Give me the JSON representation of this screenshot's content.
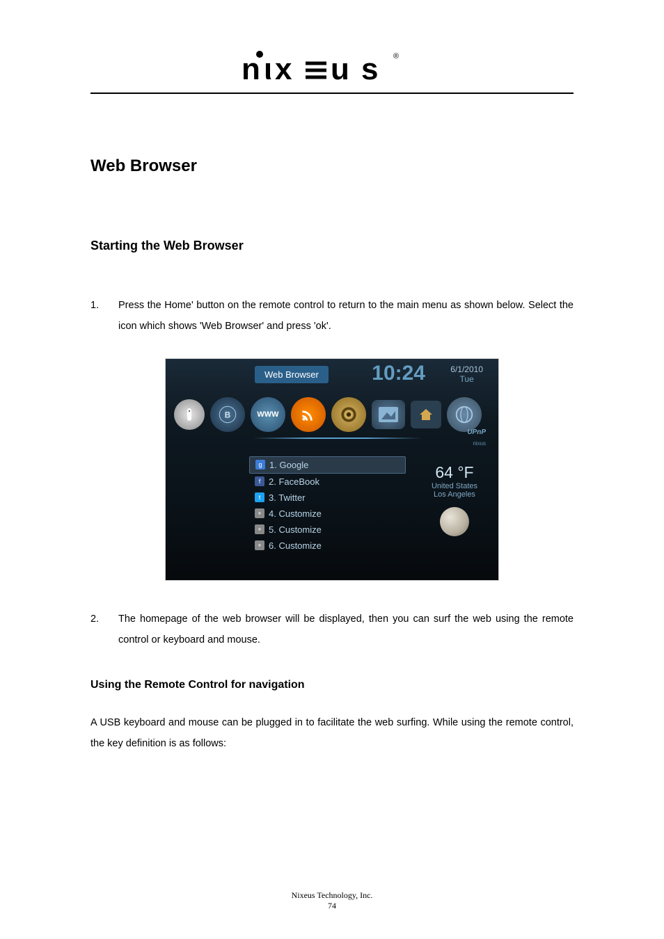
{
  "logo_text": "nixeus",
  "section_title": "Web Browser",
  "subsection_title": "Starting the Web Browser",
  "steps": [
    {
      "num": "1.",
      "text": "Press the Home' button on the remote control to return to the main menu as shown below. Select the icon which shows 'Web Browser' and press 'ok'."
    },
    {
      "num": "2.",
      "text": "The homepage of the web browser will be displayed, then you can surf the web using the remote control or keyboard and mouse."
    }
  ],
  "subsub_title": "Using the Remote Control for navigation",
  "body_para": "A USB keyboard and mouse can be plugged in to facilitate the web surfing. While using the remote control, the key definition is as follows:",
  "screenshot": {
    "title": "Web Browser",
    "time": "10:24",
    "date": "6/1/2010",
    "day": "Tue",
    "icon_www": "WWW",
    "upnp_label": "UPnP",
    "sub_label": "nixus",
    "list": [
      {
        "icon_bg": "#3b7dd8",
        "icon_char": "g",
        "label": "1. Google",
        "selected": true
      },
      {
        "icon_bg": "#3b5998",
        "icon_char": "f",
        "label": "2. FaceBook",
        "selected": false
      },
      {
        "icon_bg": "#1da1f2",
        "icon_char": "t",
        "label": "3. Twitter",
        "selected": false
      },
      {
        "icon_bg": "#888888",
        "icon_char": "+",
        "label": "4. Customize",
        "selected": false
      },
      {
        "icon_bg": "#888888",
        "icon_char": "+",
        "label": "5. Customize",
        "selected": false
      },
      {
        "icon_bg": "#888888",
        "icon_char": "+",
        "label": "6. Customize",
        "selected": false
      }
    ],
    "weather": {
      "temp": "64 °F",
      "loc1": "United States",
      "loc2": "Los Angeles"
    }
  },
  "footer_company": "Nixeus Technology, Inc.",
  "footer_page": "74"
}
